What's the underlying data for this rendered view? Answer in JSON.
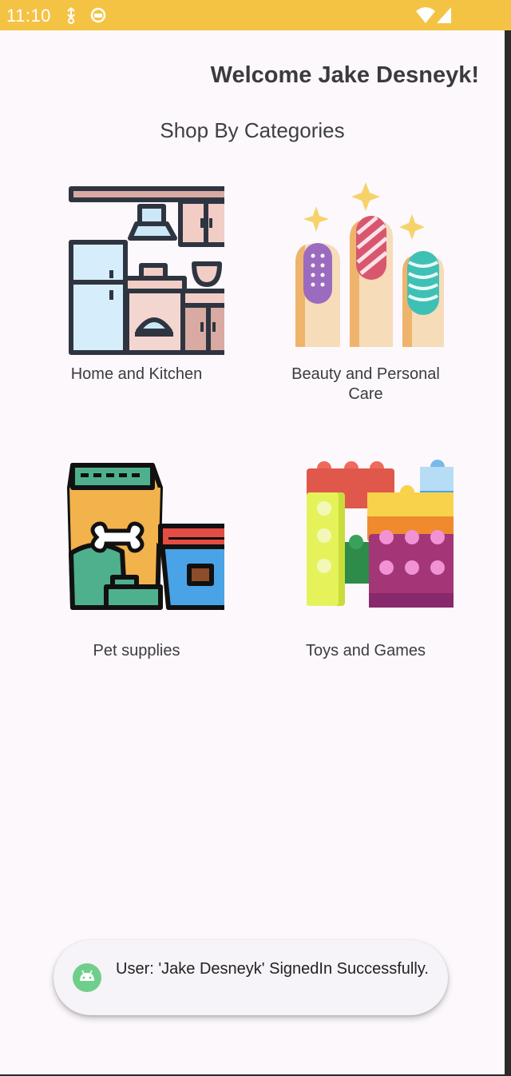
{
  "status_bar": {
    "time": "11:10",
    "icons": [
      "download-icon",
      "sync-icon",
      "wifi-icon",
      "signal-icon"
    ]
  },
  "header": {
    "welcome": "Welcome Jake Desneyk!"
  },
  "main": {
    "section_title": "Shop By Categories",
    "categories": [
      {
        "label": "Home and Kitchen",
        "icon": "kitchen-icon"
      },
      {
        "label": "Beauty and Personal Care",
        "icon": "nails-icon"
      },
      {
        "label": "Pet supplies",
        "icon": "pet-food-icon"
      },
      {
        "label": "Toys and Games",
        "icon": "building-blocks-icon"
      }
    ]
  },
  "toast": {
    "message": "User: 'Jake Desneyk' SignedIn Successfully.",
    "icon": "android-icon"
  },
  "colors": {
    "status_bar": "#f5c344",
    "background": "#fcf8fc",
    "toast_background": "#f6f3f9"
  }
}
